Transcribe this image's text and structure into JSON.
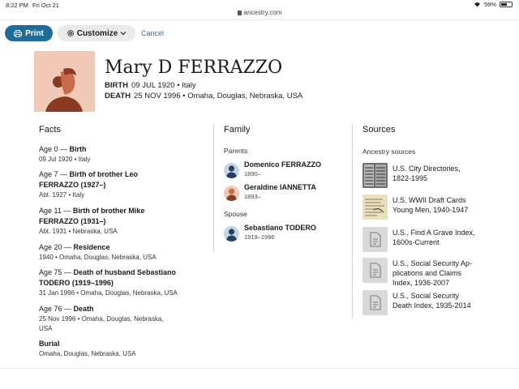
{
  "status_bar": {
    "time": "8:22 PM",
    "date": "Fri Oct 21",
    "battery": "59%",
    "battery_level": 0.59
  },
  "browser": {
    "url": "ancestry.com"
  },
  "toolbar": {
    "print_label": "Print",
    "customize_label": "Customize",
    "cancel_label": "Cancel"
  },
  "person": {
    "name": "Mary D FERRAZZO",
    "birth_label": "BIRTH",
    "birth_value": "09 JUL 1920 • Italy",
    "death_label": "DEATH",
    "death_value": "25 NOV 1996 • Omaha, Douglas, Nebraska, USA"
  },
  "facts": {
    "title": "Facts",
    "items": [
      {
        "age": "Age 0 — ",
        "event": "Birth",
        "line2": "",
        "detail": "09 Jul 1920 • Italy"
      },
      {
        "age": "Age 7 — ",
        "event": "Birth of brother Leo",
        "line2": "FERRAZZO (1927–)",
        "detail": "Abt. 1927 • Italy"
      },
      {
        "age": "Age 11 — ",
        "event": "Birth of brother Mike",
        "line2": "FERRAZZO (1931–)",
        "detail": "Abt. 1931 • Nebraska, USA"
      },
      {
        "age": "Age 20 — ",
        "event": "Residence",
        "line2": "",
        "detail": "1940 • Omaha, Douglas, Nebraska, USA"
      },
      {
        "age": "Age 75 — ",
        "event": "Death of husband Sebastiano",
        "line2": "TODERO (1919–1996)",
        "detail": "31 Jan 1996 • Omaha, Douglas, Nebraska, USA"
      },
      {
        "age": "Age 76 — ",
        "event": "Death",
        "line2": "",
        "detail": "25 Nov 1996 • Omaha, Douglas, Nebraska,",
        "detail2": "USA"
      },
      {
        "age": "",
        "event": "Burial",
        "line2": "",
        "detail": "Omaha, Douglas, Nebraska, USA"
      }
    ]
  },
  "family": {
    "title": "Family",
    "parents_label": "Parents",
    "parents": [
      {
        "name": "Domenico FERRAZZO",
        "years": "1890–"
      },
      {
        "name": "Geraldine IANNETTA",
        "years": "1893–"
      }
    ],
    "spouse_label": "Spouse",
    "spouse": {
      "name": "Sebastiano TODERO",
      "years": "1919–1996"
    }
  },
  "sources": {
    "title": "Sources",
    "label": "Ancestry sources",
    "items": [
      {
        "line1": "U.S. City Directories,",
        "line2": "1822-1995",
        "line3": "",
        "thumb": "directory-image"
      },
      {
        "line1": "U.S. WWII Draft Cards",
        "line2": "Young Men, 1940-1947",
        "line3": "",
        "thumb": "draft-card-image"
      },
      {
        "line1": "U.S., Find A Grave Index,",
        "line2": "1600s-Current",
        "line3": "",
        "thumb": "document-icon"
      },
      {
        "line1": "U.S., Social Security Ap-",
        "line2": "plications and Claims",
        "line3": "Index, 1936-2007",
        "thumb": "document-icon"
      },
      {
        "line1": "U.S., Social Security",
        "line2": "Death Index, 1935-2014",
        "line3": "",
        "thumb": "document-icon"
      }
    ]
  },
  "colors": {
    "primary": "#1f6c98",
    "link": "#2b6fb5",
    "portrait_bg": "#f1c9b7",
    "portrait_figure": "#c86a4c"
  }
}
